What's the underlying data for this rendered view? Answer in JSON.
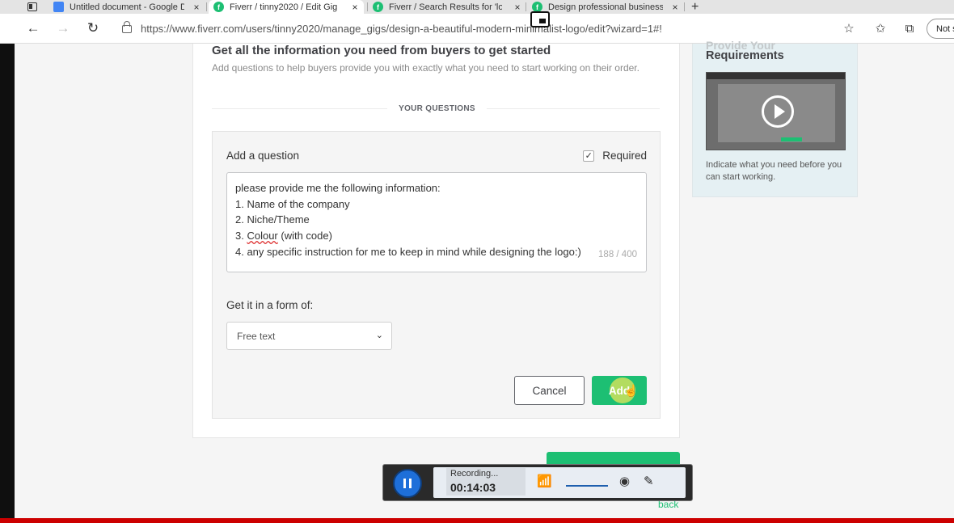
{
  "tabs": [
    {
      "title": "Untitled document - Google Do",
      "favicon_color": "#4285f4",
      "active": false
    },
    {
      "title": "Fiverr / tinny2020 / Edit Gig",
      "favicon_color": "#1dbf73",
      "active": true
    },
    {
      "title": "Fiverr / Search Results for 'logo c",
      "favicon_color": "#1dbf73",
      "active": false
    },
    {
      "title": "Design professional business log",
      "favicon_color": "#1dbf73",
      "active": false
    }
  ],
  "icons": {
    "close": "×",
    "new_tab": "+",
    "back": "←",
    "forward": "→",
    "reload": "↻",
    "favorite": "☆",
    "favorites": "✩",
    "collections": "⧉",
    "check": "✓",
    "chevron": "⌄",
    "cursor": "☝",
    "bars": "📶",
    "webcam": "◉",
    "pen": "✎"
  },
  "address_bar": {
    "url": "https://www.fiverr.com/users/tinny2020/manage_gigs/design-a-beautiful-modern-minimalist-logo/edit?wizard=1#!",
    "profile_label": "Not s"
  },
  "main": {
    "heading": "Get all the information you need from buyers to get started",
    "subheading": "Add questions to help buyers provide you with exactly what you need to start working on their order.",
    "section_label": "YOUR QUESTIONS",
    "question_form": {
      "title": "Add a question",
      "required_label": "Required",
      "required_checked": true,
      "question_lines": [
        "please provide me the following information:",
        "1. Name of the company",
        "2. Niche/Theme",
        "3. ",
        "4. any specific instruction for me to keep in mind while designing the logo:)"
      ],
      "colour_word": "Colour",
      "colour_suffix": " (with code)",
      "char_counter": "188 / 400",
      "form_label": "Get it in a form of:",
      "form_selected": "Free text",
      "cancel_label": "Cancel",
      "add_label": "Add"
    }
  },
  "sidebar": {
    "cut_heading": "Provide Your",
    "heading": "Requirements",
    "description": "Indicate what you need before you can start working."
  },
  "footer": {
    "back_label": "back"
  },
  "recorder": {
    "status": "Recording...",
    "time": "00:14:03"
  },
  "colors": {
    "brand_green": "#1dbf73",
    "recorder_blue": "#1e6fd9"
  }
}
